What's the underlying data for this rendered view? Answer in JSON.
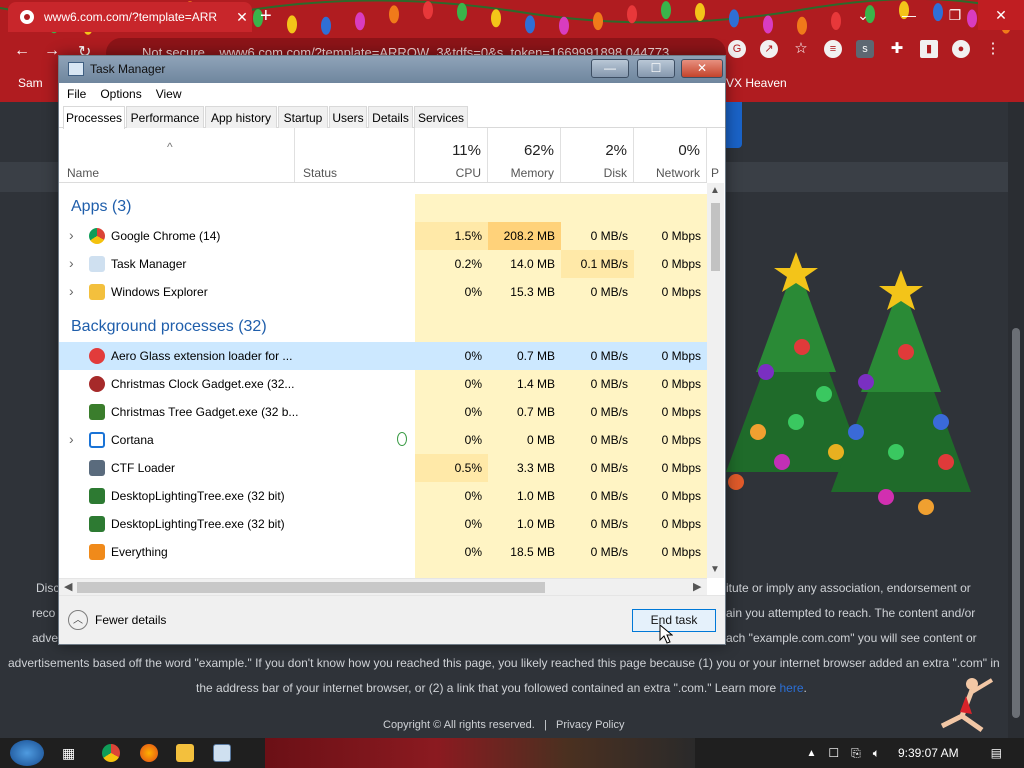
{
  "browser": {
    "tab_title": "www6.com.com/?template=ARR",
    "tab_close": "✕",
    "new_tab": "+",
    "address_prefix": "Not secure",
    "address": "www6.com.com/?template=ARROW_3&tdfs=0&s_token=1669991898.044773",
    "bookmarks": [
      "Sam",
      "VX Heaven"
    ],
    "win_minimize": "—",
    "win_restore": "❐",
    "win_close": "✕"
  },
  "page": {
    "text_line1_left": "Disc",
    "text_line1_right": "itute or imply any association, endorsement or",
    "text_line2_left": "reco",
    "text_line2_right": "ain you attempted to reach. The content and/or",
    "text_line3_left": "adve",
    "text_line3_right": "ach \"example.com.com\" you will see content or",
    "text_line4": "advertisements based off the word \"example.\" If you don't know how you reached this page, you likely reached this page because (1) you or your internet browser added an extra \".com\" in",
    "text_line5": "the address bar of your internet browser, or (2) a link that you followed contained an extra \".com.\" Learn more",
    "learn_more_link": "here",
    "footer_copyright": "Copyright © All rights reserved.",
    "footer_sep": "|",
    "footer_privacy": "Privacy Policy"
  },
  "task_manager": {
    "title": "Task Manager",
    "minimize": "—",
    "maximize": "☐",
    "close": "✕",
    "menu": [
      "File",
      "Options",
      "View"
    ],
    "tabs": [
      "Processes",
      "Performance",
      "App history",
      "Startup",
      "Users",
      "Details",
      "Services"
    ],
    "active_tab": "Processes",
    "columns": {
      "name": "Name",
      "status": "Status",
      "cpu": {
        "pct": "11%",
        "label": "CPU"
      },
      "memory": {
        "pct": "62%",
        "label": "Memory"
      },
      "disk": {
        "pct": "2%",
        "label": "Disk"
      },
      "network": {
        "pct": "0%",
        "label": "Network"
      },
      "more": "P"
    },
    "groups": {
      "apps": "Apps (3)",
      "background": "Background processes (32)"
    },
    "apps": [
      {
        "name": "Google Chrome (14)",
        "cpu": "1.5%",
        "memory": "208.2 MB",
        "disk": "0 MB/s",
        "network": "0 Mbps",
        "icon": "chrome-icon",
        "expandable": true
      },
      {
        "name": "Task Manager",
        "cpu": "0.2%",
        "memory": "14.0 MB",
        "disk": "0.1 MB/s",
        "network": "0 Mbps",
        "icon": "task-manager-icon",
        "expandable": true
      },
      {
        "name": "Windows Explorer",
        "cpu": "0%",
        "memory": "15.3 MB",
        "disk": "0 MB/s",
        "network": "0 Mbps",
        "icon": "folder-icon",
        "expandable": true
      }
    ],
    "background": [
      {
        "name": "Aero Glass extension loader for ...",
        "cpu": "0%",
        "memory": "0.7 MB",
        "disk": "0 MB/s",
        "network": "0 Mbps",
        "icon": "aero-glass-icon",
        "selected": true
      },
      {
        "name": "Christmas Clock Gadget.exe (32...",
        "cpu": "0%",
        "memory": "1.4 MB",
        "disk": "0 MB/s",
        "network": "0 Mbps",
        "icon": "clock-gadget-icon"
      },
      {
        "name": "Christmas Tree Gadget.exe (32 b...",
        "cpu": "0%",
        "memory": "0.7 MB",
        "disk": "0 MB/s",
        "network": "0 Mbps",
        "icon": "tree-gadget-icon"
      },
      {
        "name": "Cortana",
        "cpu": "0%",
        "memory": "0 MB",
        "disk": "0 MB/s",
        "network": "0 Mbps",
        "icon": "cortana-icon",
        "expandable": true,
        "status_leaf": true
      },
      {
        "name": "CTF Loader",
        "cpu": "0.5%",
        "memory": "3.3 MB",
        "disk": "0 MB/s",
        "network": "0 Mbps",
        "icon": "ctf-loader-icon"
      },
      {
        "name": "DesktopLightingTree.exe (32 bit)",
        "cpu": "0%",
        "memory": "1.0 MB",
        "disk": "0 MB/s",
        "network": "0 Mbps",
        "icon": "lighting-tree-icon"
      },
      {
        "name": "DesktopLightingTree.exe (32 bit)",
        "cpu": "0%",
        "memory": "1.0 MB",
        "disk": "0 MB/s",
        "network": "0 Mbps",
        "icon": "lighting-tree-icon"
      },
      {
        "name": "Everything",
        "cpu": "0%",
        "memory": "18.5 MB",
        "disk": "0 MB/s",
        "network": "0 Mbps",
        "icon": "everything-icon"
      }
    ],
    "fewer_details": "Fewer details",
    "end_task": "End task"
  },
  "taskbar": {
    "clock": "9:39:07 AM"
  },
  "colors": {
    "chrome_red": "#b01c20",
    "selected_row": "#cce8ff",
    "heat_light": "#fff4c4",
    "heat_mid": "#ffe9a8",
    "heat_high": "#ffd27a",
    "group_blue": "#1f5eab"
  }
}
